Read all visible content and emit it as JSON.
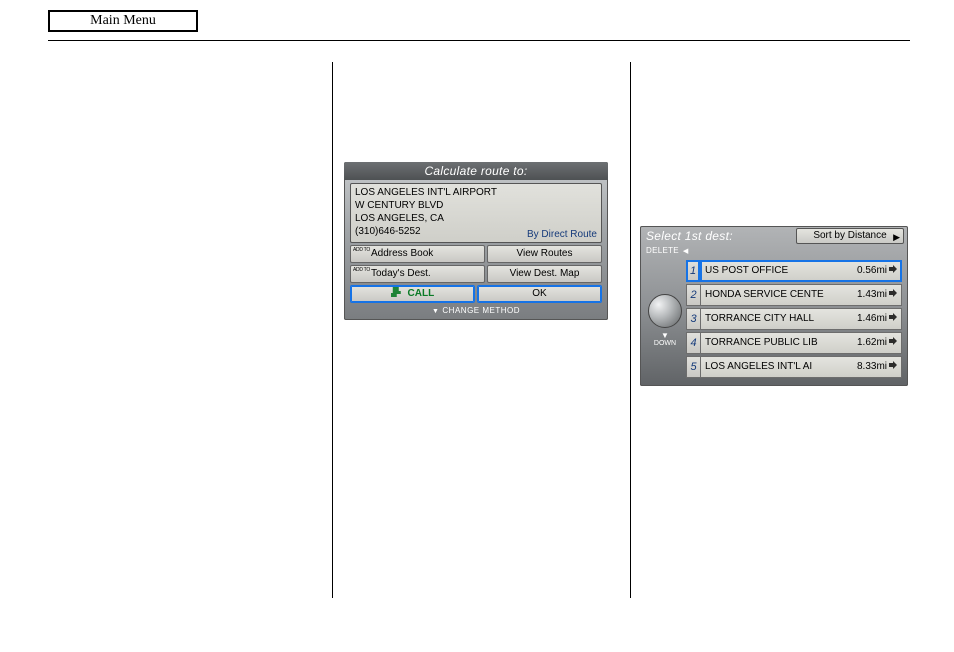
{
  "header": {
    "main_menu": "Main Menu"
  },
  "shot1": {
    "title": "Calculate route to:",
    "dest_name": "LOS ANGELES INT'L AIRPORT",
    "dest_street": "W CENTURY BLVD",
    "dest_city": "LOS ANGELES, CA",
    "dest_phone": "(310)646-5252",
    "route_mode": "By Direct Route",
    "buttons": {
      "addto_prefix": "ADD TO",
      "address_book": "Address Book",
      "view_routes": "View Routes",
      "todays_dest": "Today's Dest.",
      "view_dest_map": "View Dest. Map",
      "call": "CALL",
      "ok": "OK"
    },
    "footer": "CHANGE METHOD"
  },
  "shot2": {
    "title": "Select 1st dest:",
    "sort_button": "Sort by Distance",
    "delete_label": "DELETE",
    "down_label": "DOWN",
    "rows": [
      {
        "num": "1",
        "name": "US POST OFFICE",
        "dist": "0.56mi"
      },
      {
        "num": "2",
        "name": "HONDA SERVICE CENTE",
        "dist": "1.43mi"
      },
      {
        "num": "3",
        "name": "TORRANCE CITY HALL",
        "dist": "1.46mi"
      },
      {
        "num": "4",
        "name": "TORRANCE PUBLIC LIB",
        "dist": "1.62mi"
      },
      {
        "num": "5",
        "name": "LOS ANGELES INT'L AI",
        "dist": "8.33mi"
      }
    ]
  }
}
